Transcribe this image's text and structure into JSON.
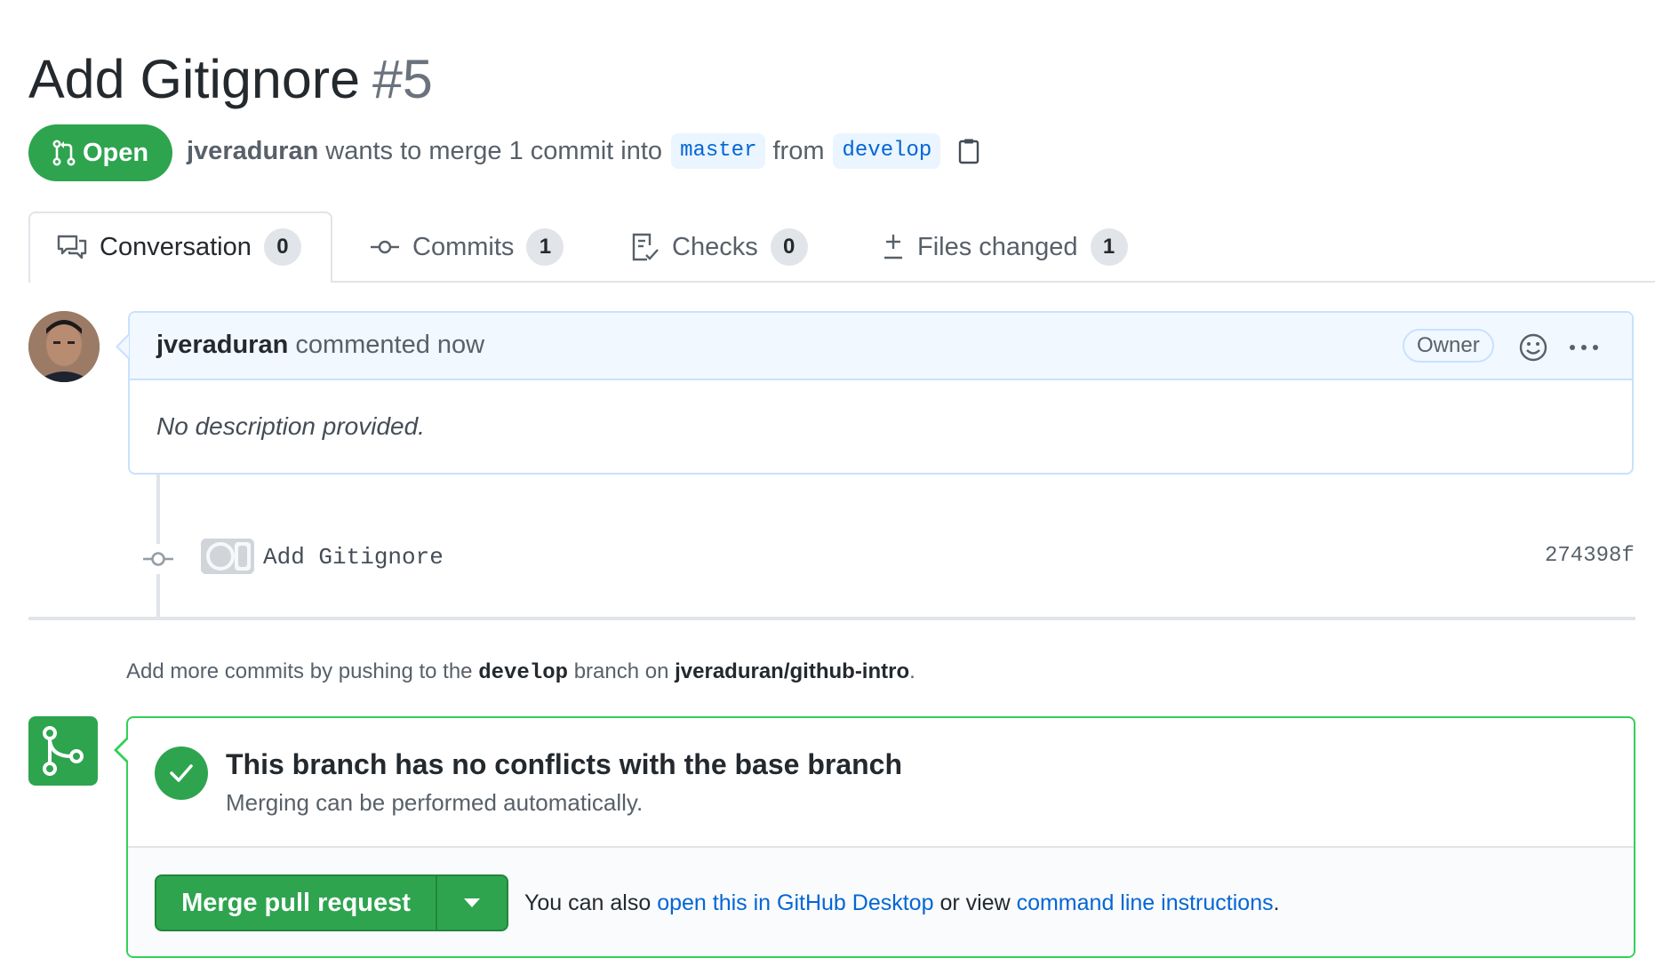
{
  "pr": {
    "title": "Add Gitignore",
    "number": "#5",
    "state": "Open",
    "author": "jveraduran",
    "merge_text": "wants to merge 1 commit into",
    "base_branch": "master",
    "from_text": "from",
    "head_branch": "develop"
  },
  "tabs": [
    {
      "label": "Conversation",
      "count": "0",
      "icon": "comment-discussion-icon"
    },
    {
      "label": "Commits",
      "count": "1",
      "icon": "git-commit-icon"
    },
    {
      "label": "Checks",
      "count": "0",
      "icon": "checklist-icon"
    },
    {
      "label": "Files changed",
      "count": "1",
      "icon": "diff-icon"
    }
  ],
  "comment": {
    "author": "jveraduran",
    "action": "commented now",
    "role_badge": "Owner",
    "body": "No description provided."
  },
  "commit": {
    "message": "Add Gitignore",
    "sha": "274398f"
  },
  "push_note": {
    "prefix": "Add more commits by pushing to the",
    "branch": "develop",
    "middle": "branch on",
    "repo": "jveraduran/github-intro",
    "suffix": "."
  },
  "merge": {
    "title": "This branch has no conflicts with the base branch",
    "subtitle": "Merging can be performed automatically.",
    "button_label": "Merge pull request",
    "also_prefix": "You can also",
    "desktop_link": "open this in GitHub Desktop",
    "or_view": "or view",
    "cli_link": "command line instructions",
    "suffix": "."
  },
  "colors": {
    "open_green": "#2ea44f",
    "link_blue": "#0366d6",
    "branch_bg": "#eaf5ff"
  }
}
